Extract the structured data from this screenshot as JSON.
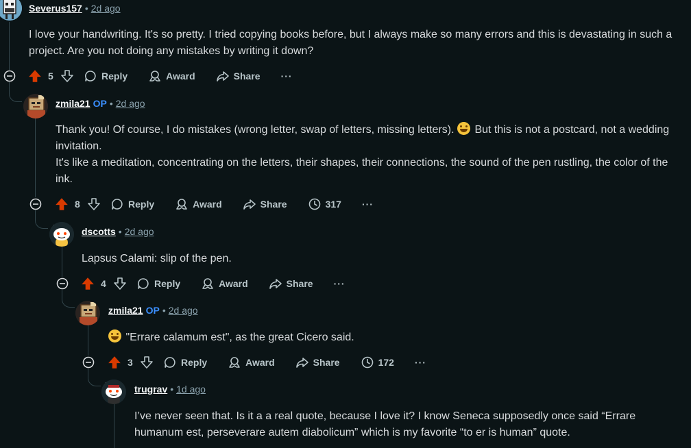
{
  "comments": [
    {
      "author": "Severus157",
      "op": "",
      "time": "2d ago",
      "paragraphs": [
        "I love your handwriting. It's so pretty. I tried copying books before, but I always make so many errors and this is devastating in such a project. Are you not doing any mistakes by writing it down?"
      ],
      "votes": "5",
      "reply": "Reply",
      "award": "Award",
      "share": "Share",
      "views": "",
      "avatar": "severus-avatar"
    },
    {
      "author": "zmila21",
      "op": "OP",
      "time": "2d ago",
      "paragraphs": [
        "Thank you! Of course, I do mistakes (wrong letter, swap of letters, missing letters). ",
        " But this is not a postcard, not a wedding invitation.",
        "It's like a meditation, concentrating on the letters, their shapes, their connections, the sound of the pen rustling, the color of the ink."
      ],
      "votes": "8",
      "reply": "Reply",
      "award": "Award",
      "share": "Share",
      "views": "317",
      "avatar": "zmila-avatar"
    },
    {
      "author": "dscotts",
      "op": "",
      "time": "2d ago",
      "paragraphs": [
        "Lapsus Calami: slip of the pen."
      ],
      "votes": "4",
      "reply": "Reply",
      "award": "Award",
      "share": "Share",
      "views": "",
      "avatar": "snoo-avatar"
    },
    {
      "author": "zmila21",
      "op": "OP",
      "time": "2d ago",
      "paragraphs": [
        " \"Errare calamum est\", as the great Cicero said."
      ],
      "votes": "3",
      "reply": "Reply",
      "award": "Award",
      "share": "Share",
      "views": "172",
      "avatar": "zmila-avatar"
    },
    {
      "author": "trugrav",
      "op": "",
      "time": "1d ago",
      "paragraphs": [
        "I’ve never seen that. Is it a a real quote, because I love it? I know Seneca supposedly once said “Errare humanum est, perseverare autem diabolicum” which is my favorite “to er is human” quote."
      ],
      "avatar": "snoo-avatar"
    }
  ],
  "more_label": "···",
  "colors": {
    "upvote": "#d93a00",
    "op": "#3b8fff",
    "thread_line": "#33464c",
    "background": "#0b1416"
  },
  "icons": [
    "upvote-icon",
    "downvote-icon",
    "reply-bubble-icon",
    "award-icon",
    "share-arrow-icon",
    "views-icon",
    "collapse-icon",
    "more-icon"
  ]
}
